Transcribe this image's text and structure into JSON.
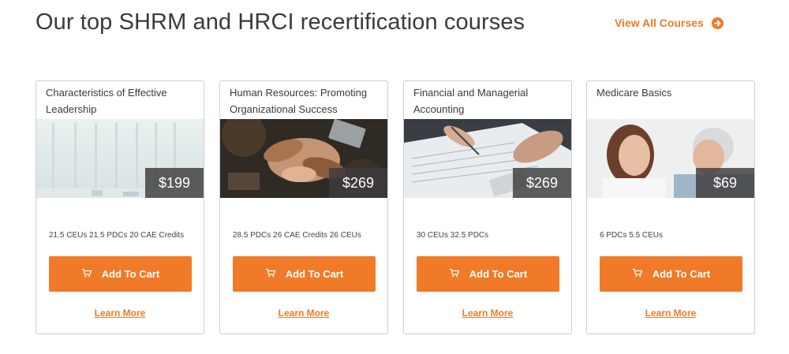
{
  "header": {
    "title": "Our top SHRM and HRCI recertification courses",
    "view_all_label": "View All Courses"
  },
  "colors": {
    "accent": "#f07a28",
    "price_overlay": "#3c3c3c",
    "border": "#cfcfcf"
  },
  "icons": {
    "view_all": "circle-arrow-right-icon",
    "cart": "shopping-cart-icon"
  },
  "courses": [
    {
      "title": "Characteristics of Effective Leadership",
      "price": "$199",
      "credits": "21.5 CEUs 21.5 PDCs 20 CAE Credits",
      "cart_label": "Add To Cart",
      "learn_more_label": "Learn More",
      "image": "office-interior-photo"
    },
    {
      "title": "Human Resources: Promoting Organizational Success",
      "price": "$269",
      "credits": "28.5 PDCs 26 CAE Credits 26 CEUs",
      "cart_label": "Add To Cart",
      "learn_more_label": "Learn More",
      "image": "team-hands-together-photo"
    },
    {
      "title": "Financial and Managerial Accounting",
      "price": "$269",
      "credits": "30 CEUs 32.5 PDCs",
      "cart_label": "Add To Cart",
      "learn_more_label": "Learn More",
      "image": "accounting-documents-photo"
    },
    {
      "title": "Medicare Basics",
      "price": "$69",
      "credits": "6 PDCs 5.5 CEUs",
      "cart_label": "Add To Cart",
      "learn_more_label": "Learn More",
      "image": "caregiver-with-senior-photo"
    }
  ]
}
